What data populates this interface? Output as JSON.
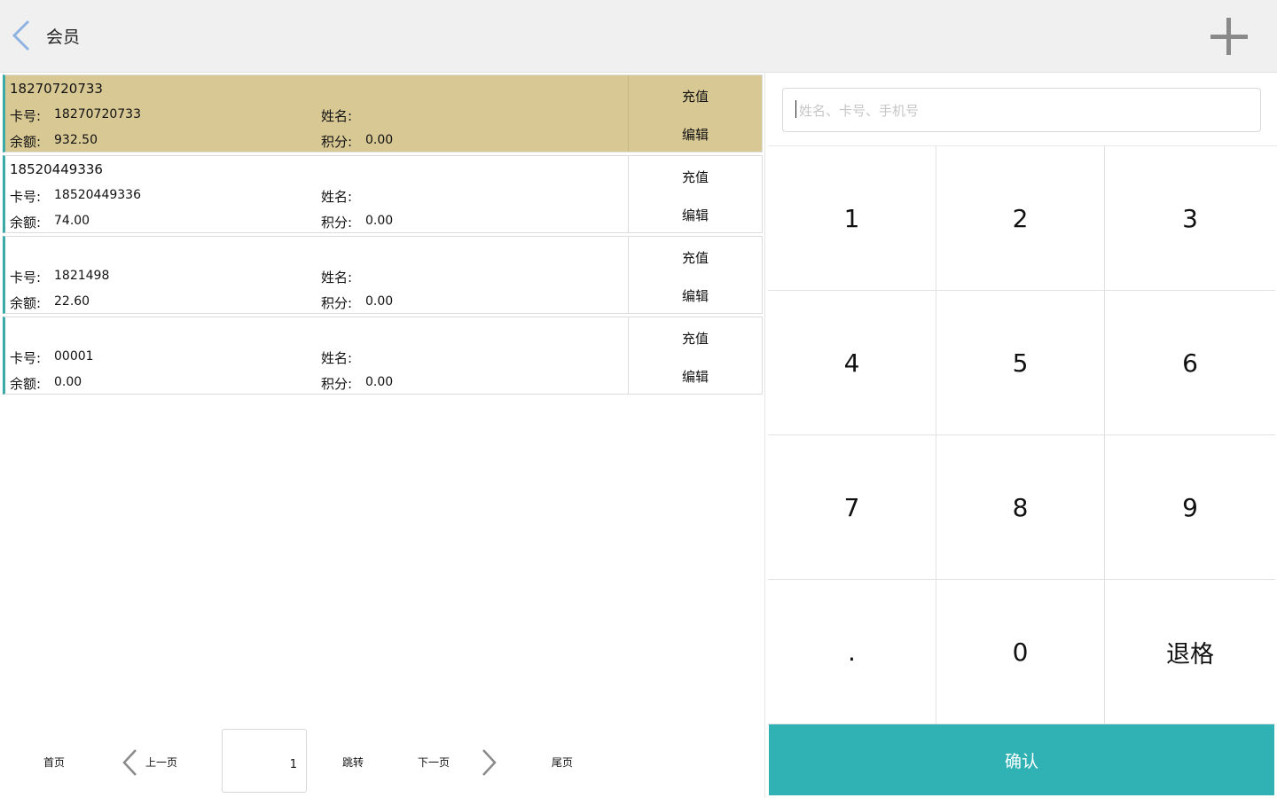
{
  "header": {
    "title": "会员"
  },
  "labels": {
    "card_no": "卡号:",
    "name": "姓名:",
    "balance": "余额:",
    "points": "积分:",
    "recharge": "充值",
    "edit": "编辑"
  },
  "members": [
    {
      "phone": "18270720733",
      "card_no": "18270720733",
      "name": "",
      "balance": "932.50",
      "points": "0.00",
      "selected": true
    },
    {
      "phone": "18520449336",
      "card_no": "18520449336",
      "name": "",
      "balance": "74.00",
      "points": "0.00",
      "selected": false
    },
    {
      "phone": "",
      "card_no": "1821498",
      "name": "",
      "balance": "22.60",
      "points": "0.00",
      "selected": false
    },
    {
      "phone": "",
      "card_no": "00001",
      "name": "",
      "balance": "0.00",
      "points": "0.00",
      "selected": false
    }
  ],
  "pagination": {
    "first": "首页",
    "prev": "上一页",
    "current_page": "1",
    "jump": "跳转",
    "next": "下一页",
    "last": "尾页"
  },
  "search": {
    "placeholder": "姓名、卡号、手机号",
    "value": ""
  },
  "keypad": {
    "keys": [
      "1",
      "2",
      "3",
      "4",
      "5",
      "6",
      "7",
      "8",
      "9",
      ".",
      "0",
      "退格"
    ]
  },
  "confirm_label": "确认",
  "colors": {
    "accent": "#30b2b4",
    "selected_row": "#d8c894",
    "row_marker": "#3aa9a7",
    "back_arrow": "#8fb4e0"
  },
  "icons": {
    "back": "chevron-left-icon",
    "add": "plus-icon",
    "prev": "chevron-left-icon",
    "next": "chevron-right-icon"
  }
}
